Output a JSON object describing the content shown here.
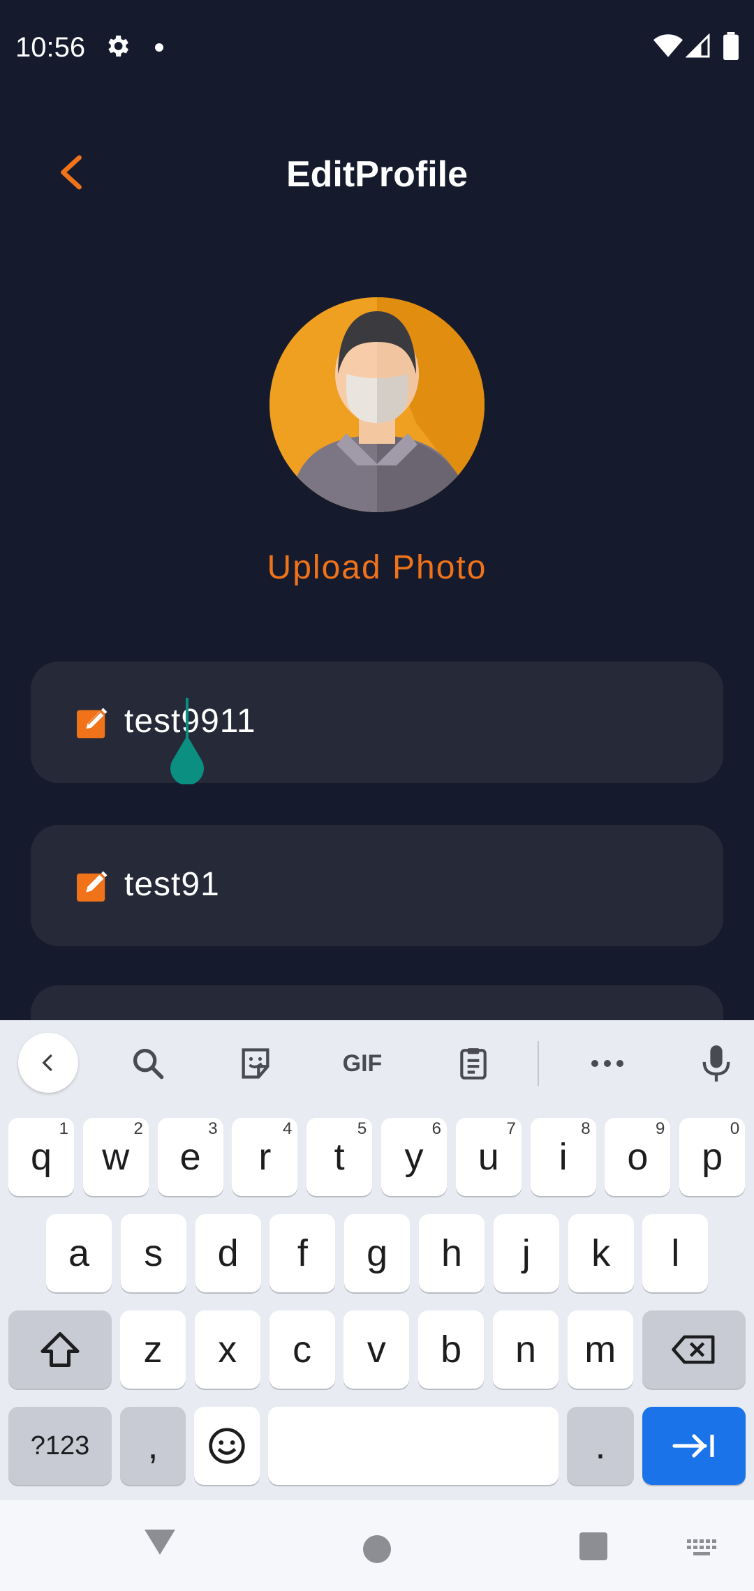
{
  "status_bar": {
    "time": "10:56"
  },
  "header": {
    "title": "EditProfile"
  },
  "profile": {
    "upload_label": "Upload Photo"
  },
  "fields": [
    {
      "value": "test9911"
    },
    {
      "value": "test91"
    }
  ],
  "keyboard": {
    "row1": [
      {
        "k": "q",
        "h": "1"
      },
      {
        "k": "w",
        "h": "2"
      },
      {
        "k": "e",
        "h": "3"
      },
      {
        "k": "r",
        "h": "4"
      },
      {
        "k": "t",
        "h": "5"
      },
      {
        "k": "y",
        "h": "6"
      },
      {
        "k": "u",
        "h": "7"
      },
      {
        "k": "i",
        "h": "8"
      },
      {
        "k": "o",
        "h": "9"
      },
      {
        "k": "p",
        "h": "0"
      }
    ],
    "row2": [
      "a",
      "s",
      "d",
      "f",
      "g",
      "h",
      "j",
      "k",
      "l"
    ],
    "row3": [
      "z",
      "x",
      "c",
      "v",
      "b",
      "n",
      "m"
    ],
    "symbols_label": "?123",
    "comma": ",",
    "period": ".",
    "toolbar_gif": "GIF"
  },
  "colors": {
    "accent": "#f0731a",
    "background": "#151a2d",
    "card": "#262a38",
    "cursor": "#0a8f80",
    "enter_key": "#1a73e8"
  }
}
